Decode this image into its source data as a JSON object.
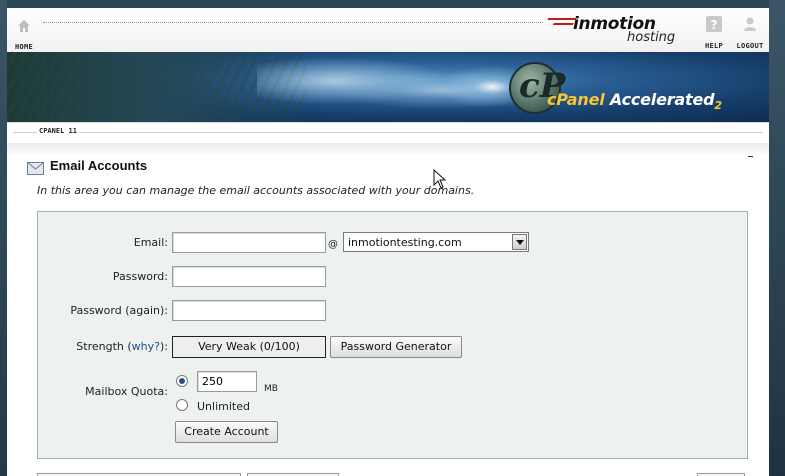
{
  "nav": {
    "home_label": "HOME",
    "help_label": "HELP",
    "logout_label": "LOGOUT"
  },
  "brand": {
    "name": "inmotion",
    "sub": "hosting",
    "cpanel_name": "cPanel",
    "cpanel_accent": "Accelerated",
    "cpanel_version_mark": "2",
    "accent_color": "#c21a1a"
  },
  "version_tag": "CPANEL 11",
  "header": {
    "title": "Email Accounts",
    "intro": "In this area you can manage the email accounts associated with your domains."
  },
  "form": {
    "email_label": "Email:",
    "email_value": "",
    "at_sign": "@",
    "domain_selected": "inmotiontesting.com",
    "password_label": "Password:",
    "password_value": "",
    "password_again_label": "Password (again):",
    "password_again_value": "",
    "strength_label": "Strength",
    "strength_open": "(",
    "strength_why": "why?",
    "strength_close": "):",
    "strength_value": "Very Weak (0/100)",
    "generator_button": "Password Generator",
    "quota_label": "Mailbox Quota:",
    "quota_value": "250",
    "quota_unit": "MB",
    "quota_unlimited": "Unlimited",
    "quota_selected": "value",
    "create_button": "Create Account"
  }
}
